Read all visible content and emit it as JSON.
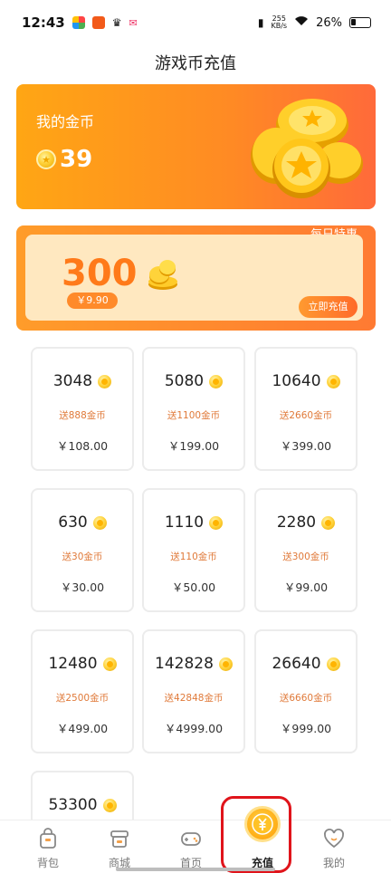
{
  "status_bar": {
    "time": "12:43",
    "net_speed_value": "255",
    "net_speed_unit": "KB/s",
    "battery": "26%"
  },
  "header": {
    "title": "游戏币充值"
  },
  "balance": {
    "label": "我的金币",
    "value": "39"
  },
  "daily_deal": {
    "tag": "每日特惠",
    "amount": "300",
    "price": "￥9.90",
    "button": "立即充值"
  },
  "packages": [
    {
      "amount": "3048",
      "bonus": "送888金币",
      "price": "￥108.00"
    },
    {
      "amount": "5080",
      "bonus": "送1100金币",
      "price": "￥199.00"
    },
    {
      "amount": "10640",
      "bonus": "送2660金币",
      "price": "￥399.00"
    },
    {
      "amount": "630",
      "bonus": "送30金币",
      "price": "￥30.00"
    },
    {
      "amount": "1110",
      "bonus": "送110金币",
      "price": "￥50.00"
    },
    {
      "amount": "2280",
      "bonus": "送300金币",
      "price": "￥99.00"
    },
    {
      "amount": "12480",
      "bonus": "送2500金币",
      "price": "￥499.00"
    },
    {
      "amount": "142828",
      "bonus": "送42848金币",
      "price": "￥4999.00"
    },
    {
      "amount": "26640",
      "bonus": "送6660金币",
      "price": "￥999.00"
    },
    {
      "amount": "53300",
      "bonus": "",
      "price": ""
    }
  ],
  "bottom_nav": {
    "items": [
      {
        "label": "背包",
        "icon": "bag-icon"
      },
      {
        "label": "商城",
        "icon": "shop-icon"
      },
      {
        "label": "首页",
        "icon": "gamepad-icon"
      },
      {
        "label": "充值",
        "icon": "yuan-coin-icon",
        "active": true
      },
      {
        "label": "我的",
        "icon": "heart-face-icon"
      }
    ]
  },
  "colors": {
    "accent": "#ff8a24",
    "highlight": "#e0141b"
  }
}
